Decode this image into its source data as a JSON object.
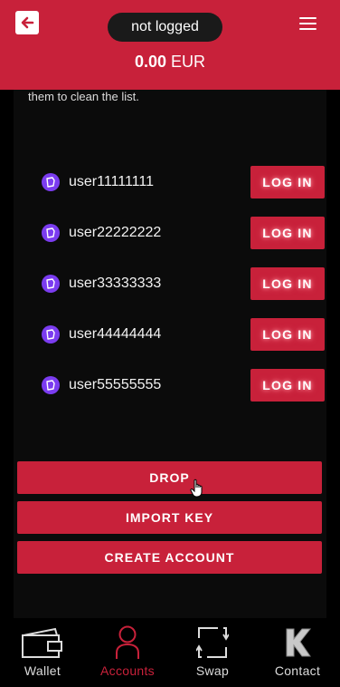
{
  "header": {
    "status": "not logged",
    "balance_amount": "0.00",
    "balance_currency": "EUR"
  },
  "panel": {
    "note": "them to clean the list."
  },
  "accounts": [
    {
      "name": "user11111111",
      "action": "LOG IN"
    },
    {
      "name": "user22222222",
      "action": "LOG IN"
    },
    {
      "name": "user33333333",
      "action": "LOG IN"
    },
    {
      "name": "user44444444",
      "action": "LOG IN"
    },
    {
      "name": "user55555555",
      "action": "LOG IN"
    }
  ],
  "actions": {
    "drop": "DROP",
    "import_key": "IMPORT KEY",
    "create_account": "CREATE ACCOUNT"
  },
  "tabs": [
    {
      "label": "Wallet",
      "icon": "wallet-icon"
    },
    {
      "label": "Accounts",
      "icon": "person-icon",
      "active": true
    },
    {
      "label": "Swap",
      "icon": "swap-icon"
    },
    {
      "label": "Contact",
      "icon": "k-logo-icon"
    }
  ],
  "colors": {
    "accent": "#c8213a",
    "avatar": "#7b3cf0",
    "background": "#000000",
    "panel": "#0b0b0b"
  }
}
